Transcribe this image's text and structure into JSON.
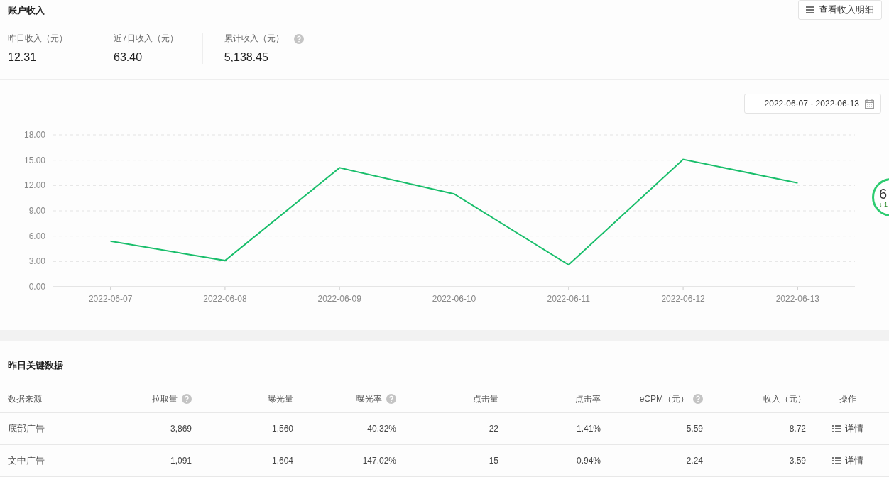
{
  "account": {
    "title": "账户收入",
    "detail_button": "查看收入明细",
    "stats": [
      {
        "label": "昨日收入（元）",
        "value": "12.31",
        "help": false
      },
      {
        "label": "近7日收入（元）",
        "value": "63.40",
        "help": false
      },
      {
        "label": "累计收入（元）",
        "value": "5,138.45",
        "help": true
      }
    ]
  },
  "date_range": "2022-06-07 - 2022-06-13",
  "chart": {
    "chart_data": {
      "type": "line",
      "categories": [
        "2022-06-07",
        "2022-06-08",
        "2022-06-09",
        "2022-06-10",
        "2022-06-11",
        "2022-06-12",
        "2022-06-13"
      ],
      "ylim": [
        0,
        18
      ],
      "grid": true,
      "yticks": [
        {
          "value": 0,
          "label": "0.00"
        },
        {
          "value": 3,
          "label": "3.00"
        },
        {
          "value": 6,
          "label": "6.00"
        },
        {
          "value": 9,
          "label": "9.00"
        },
        {
          "value": 12,
          "label": "12.00"
        },
        {
          "value": 15,
          "label": "15.00"
        },
        {
          "value": 18,
          "label": "18.00"
        }
      ],
      "series": [
        {
          "color": "#19be6b",
          "values": [
            5.4,
            3.1,
            14.1,
            11.0,
            2.6,
            15.1,
            12.3
          ]
        }
      ]
    }
  },
  "float_widget": {
    "value": "6",
    "sub": "↓ 1"
  },
  "table": {
    "title": "昨日关键数据",
    "columns": [
      {
        "label": "数据来源",
        "help": false
      },
      {
        "label": "拉取量",
        "help": true
      },
      {
        "label": "曝光量",
        "help": false
      },
      {
        "label": "曝光率",
        "help": true
      },
      {
        "label": "点击量",
        "help": false
      },
      {
        "label": "点击率",
        "help": false
      },
      {
        "label": "eCPM（元）",
        "help": true
      },
      {
        "label": "收入（元）",
        "help": false
      },
      {
        "label": "操作",
        "help": false
      }
    ],
    "rows": [
      {
        "cells": [
          "底部广告",
          "3,869",
          "1,560",
          "40.32%",
          "22",
          "1.41%",
          "5.59",
          "8.72"
        ],
        "action": "详情"
      },
      {
        "cells": [
          "文中广告",
          "1,091",
          "1,604",
          "147.02%",
          "15",
          "0.94%",
          "2.24",
          "3.59"
        ],
        "action": "详情"
      }
    ]
  }
}
